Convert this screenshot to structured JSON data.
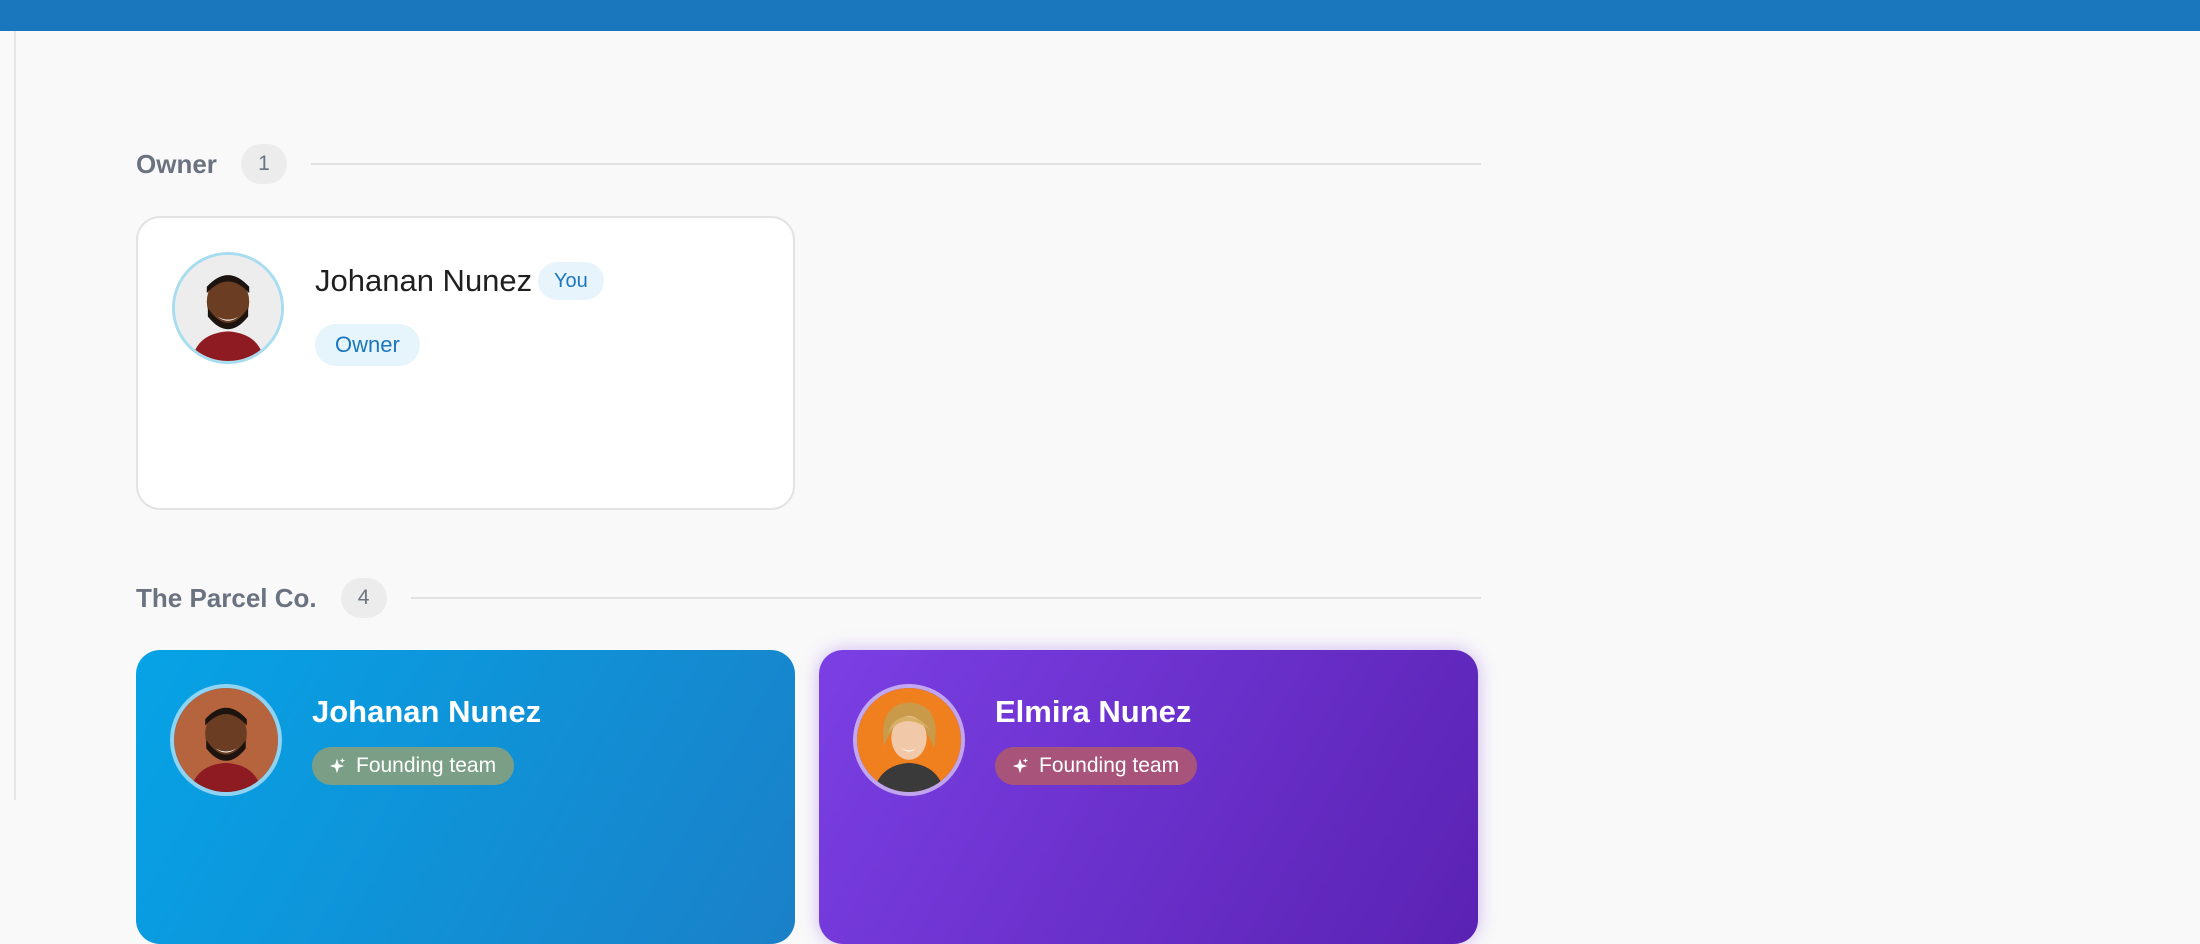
{
  "sections": [
    {
      "title": "Owner",
      "count": "1",
      "members": [
        {
          "name": "Johanan Nunez",
          "you_label": "You",
          "role": "Owner",
          "avatar_icon": "person-photo-icon"
        }
      ]
    },
    {
      "title": "The Parcel Co.",
      "count": "4",
      "members": [
        {
          "name": "Johanan Nunez",
          "tag": "Founding team",
          "card_color": "#1a8fd6",
          "avatar_icon": "person-photo-icon"
        },
        {
          "name": "Elmira Nunez",
          "tag": "Founding team",
          "card_color": "#6a2fd0",
          "avatar_icon": "person-photo-icon"
        }
      ]
    }
  ],
  "colors": {
    "topbar": "#1b77bd",
    "accent": "#1b77bd",
    "background": "#f9f9f9"
  },
  "icons": {
    "tag_icon": "sparkle-icon"
  }
}
